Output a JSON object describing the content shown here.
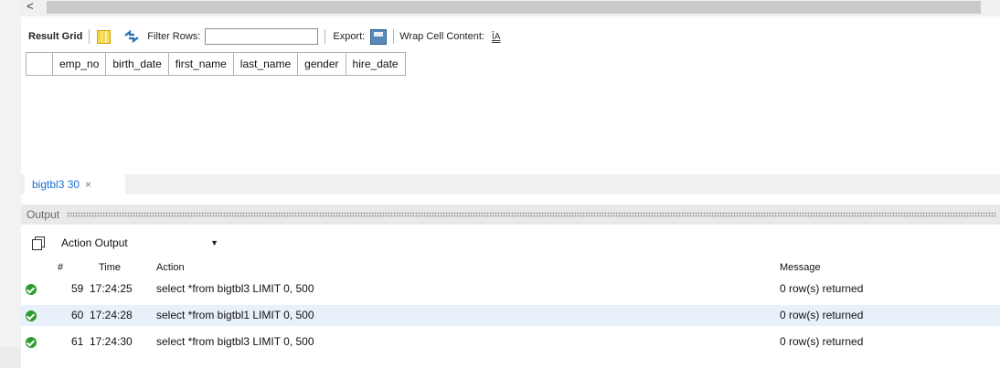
{
  "scrollbar": {
    "left_arrow": "<"
  },
  "toolbar": {
    "result_grid": "Result Grid",
    "filter_rows": "Filter Rows:",
    "filter_value": "",
    "export": "Export:",
    "wrap_cell_content": "Wrap Cell Content:",
    "wrap_icon_glyph": "ĪA"
  },
  "grid": {
    "columns": [
      "emp_no",
      "birth_date",
      "first_name",
      "last_name",
      "gender",
      "hire_date"
    ]
  },
  "tab": {
    "label": "bigtbl3 30",
    "close": "×"
  },
  "output": {
    "title": "Output",
    "selector": "Action Output",
    "headers": {
      "num": "#",
      "time": "Time",
      "action": "Action",
      "message": "Message"
    },
    "rows": [
      {
        "num": "59",
        "time": "17:24:25",
        "action": "select *from bigtbl3 LIMIT 0, 500",
        "message": "0 row(s) returned"
      },
      {
        "num": "60",
        "time": "17:24:28",
        "action": "select *from bigtbl1 LIMIT 0, 500",
        "message": "0 row(s) returned"
      },
      {
        "num": "61",
        "time": "17:24:30",
        "action": "select *from bigtbl3 LIMIT 0, 500",
        "message": "0 row(s) returned"
      }
    ]
  },
  "icons": {
    "status_ok": "check-circle-icon",
    "colors": {
      "ok_green": "#2e9b32",
      "tab_blue": "#1d6fd1",
      "row_selected": "#e8f0fa"
    }
  }
}
